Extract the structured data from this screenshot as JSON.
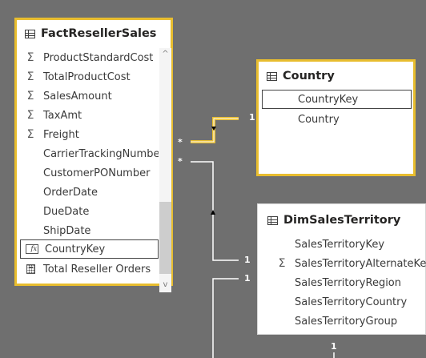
{
  "fact_table": {
    "title": "FactResellerSales",
    "fields": [
      {
        "label": "ProductStandardCost",
        "icon": "sigma-icon"
      },
      {
        "label": "TotalProductCost",
        "icon": "sigma-icon"
      },
      {
        "label": "SalesAmount",
        "icon": "sigma-icon"
      },
      {
        "label": "TaxAmt",
        "icon": "sigma-icon"
      },
      {
        "label": "Freight",
        "icon": "sigma-icon"
      },
      {
        "label": "CarrierTrackingNumber",
        "icon": ""
      },
      {
        "label": "CustomerPONumber",
        "icon": ""
      },
      {
        "label": "OrderDate",
        "icon": ""
      },
      {
        "label": "DueDate",
        "icon": ""
      },
      {
        "label": "ShipDate",
        "icon": ""
      },
      {
        "label": "CountryKey",
        "icon": "calculated-column-icon"
      },
      {
        "label": "Total Reseller Orders",
        "icon": "measure-icon"
      }
    ],
    "scroll_up": "^",
    "scroll_down": "v"
  },
  "country_table": {
    "title": "Country",
    "fields": [
      {
        "label": "CountryKey"
      },
      {
        "label": "Country"
      }
    ]
  },
  "territory_table": {
    "title": "DimSalesTerritory",
    "fields": [
      {
        "label": "SalesTerritoryKey",
        "icon": ""
      },
      {
        "label": "SalesTerritoryAlternateKey",
        "icon": "sigma-icon"
      },
      {
        "label": "SalesTerritoryRegion",
        "icon": ""
      },
      {
        "label": "SalesTerritoryCountry",
        "icon": ""
      },
      {
        "label": "SalesTerritoryGroup",
        "icon": ""
      }
    ]
  },
  "relationships": {
    "many_label": "*",
    "one_label": "1",
    "sigma_glyph": "Σ",
    "highlight_color": "#e8bd2f",
    "line_color": "#ffffff"
  }
}
